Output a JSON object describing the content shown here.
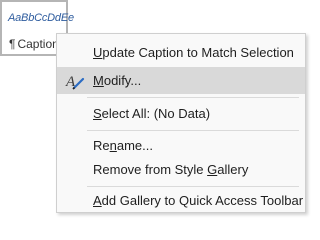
{
  "style_gallery": {
    "preview_text": "AaBbCcDdEe",
    "style_name": "Caption",
    "pilcrow": "¶"
  },
  "context_menu": {
    "items": [
      {
        "label_before": "",
        "label_underline": "U",
        "label_after": "pdate Caption to Match Selection",
        "icon": null,
        "highlighted": false
      },
      {
        "label_before": "",
        "label_underline": "M",
        "label_after": "odify...",
        "icon": "modify-style-icon",
        "highlighted": true
      },
      {
        "label_before": "",
        "label_underline": "S",
        "label_after": "elect All: (No Data)",
        "icon": null,
        "highlighted": false
      },
      {
        "label_before": "Re",
        "label_underline": "n",
        "label_after": "ame...",
        "icon": null,
        "highlighted": false
      },
      {
        "label_before": "Remove from Style ",
        "label_underline": "G",
        "label_after": "allery",
        "icon": null,
        "highlighted": false
      },
      {
        "label_before": "",
        "label_underline": "A",
        "label_after": "dd Gallery to Quick Access Toolbar",
        "icon": null,
        "highlighted": false
      }
    ]
  },
  "colors": {
    "highlight": "#d9d9d9",
    "menu_background": "#f9f9f9",
    "preview_text": "#2e5c9e",
    "icon_pen": "#2b6cc4"
  }
}
